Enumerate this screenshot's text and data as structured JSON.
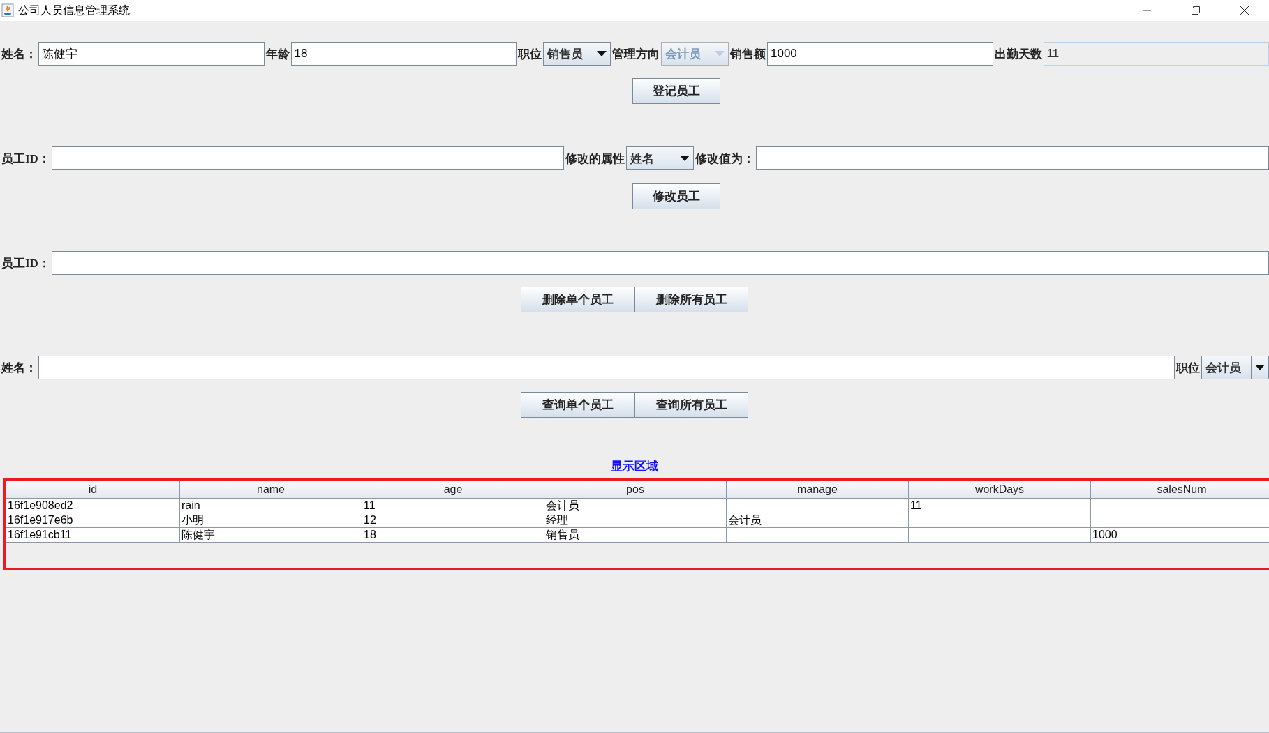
{
  "window": {
    "title": "公司人员信息管理系统"
  },
  "register": {
    "items": [
      {
        "kind": "field",
        "label": "姓名：",
        "value": "陈健宇",
        "disabled": false
      },
      {
        "kind": "field",
        "label": "年龄",
        "value": "18",
        "disabled": false
      },
      {
        "kind": "combo",
        "label": "职位",
        "value": "销售员",
        "disabled": false
      },
      {
        "kind": "combo",
        "label": "管理方向",
        "value": "会计员",
        "disabled": true
      },
      {
        "kind": "field",
        "label": "销售额",
        "value": "1000",
        "disabled": false
      },
      {
        "kind": "field",
        "label": "出勤天数",
        "value": "11",
        "disabled": true
      }
    ],
    "buttons": [
      "登记员工"
    ]
  },
  "modify": {
    "items": [
      {
        "kind": "field",
        "label": "员工ID：",
        "disabled": false
      },
      {
        "kind": "combo",
        "label": "修改的属性",
        "value": "姓名",
        "disabled": false
      },
      {
        "kind": "field",
        "label": "修改值为：",
        "disabled": false
      }
    ],
    "buttons": [
      "修改员工"
    ]
  },
  "delete": {
    "items": [
      {
        "kind": "field",
        "label": "员工ID：",
        "disabled": false
      }
    ],
    "buttons": [
      "删除单个员工",
      "删除所有员工"
    ]
  },
  "query": {
    "items": [
      {
        "kind": "field",
        "label": "姓名：",
        "disabled": false
      },
      {
        "kind": "combo",
        "label": "职位",
        "value": "会计员",
        "disabled": false
      }
    ],
    "buttons": [
      "查询单个员工",
      "查询所有员工"
    ]
  },
  "display": {
    "title": "显示区域",
    "table": {
      "columns": [
        "id",
        "name",
        "age",
        "pos",
        "manage",
        "workDays",
        "salesNum"
      ],
      "rows": [
        [
          "16f1e908ed2",
          "rain",
          "11",
          "会计员",
          "",
          "11",
          ""
        ],
        [
          "16f1e917e6b",
          "小明",
          "12",
          "经理",
          "会计员",
          "",
          ""
        ],
        [
          "16f1e91cb11",
          "陈健宇",
          "18",
          "销售员",
          "",
          "",
          "1000"
        ]
      ]
    }
  }
}
